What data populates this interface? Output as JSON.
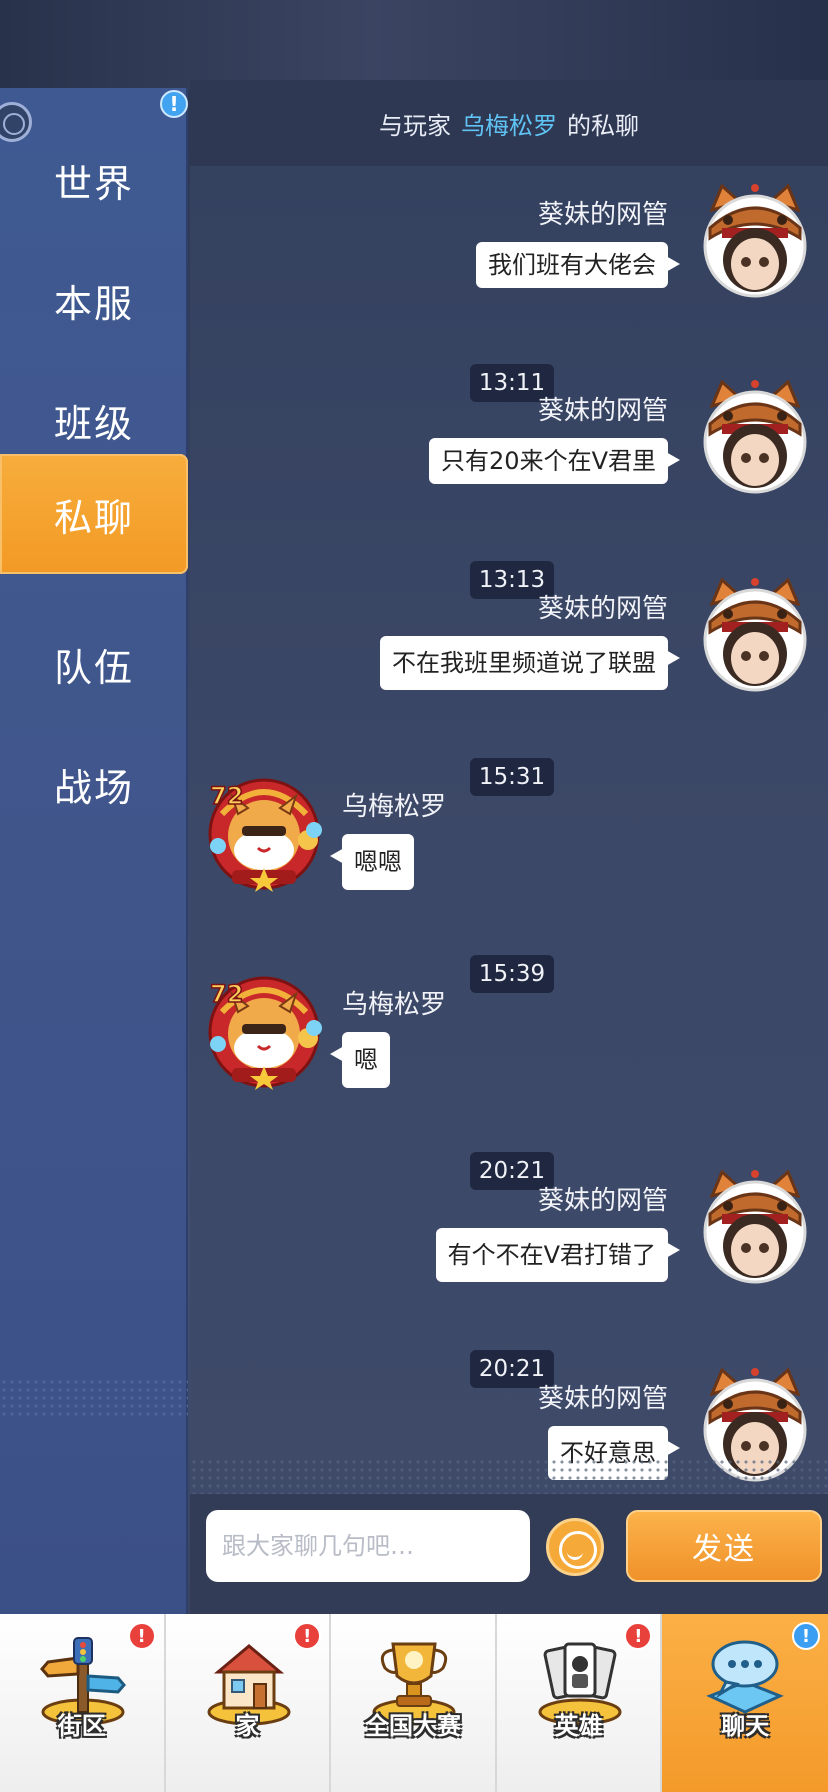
{
  "sidebar": {
    "items": [
      {
        "label": "世界"
      },
      {
        "label": "本服"
      },
      {
        "label": "班级"
      },
      {
        "label": "私聊"
      },
      {
        "label": "队伍"
      },
      {
        "label": "战场"
      }
    ],
    "active_index": 3,
    "alert_text": "!"
  },
  "chat": {
    "header_prefix": "与玩家",
    "header_name": "乌梅松罗",
    "header_suffix": "的私聊",
    "messages": [
      {
        "sender": "葵妹的网管",
        "text": "我们班有大佬会"
      },
      {
        "sender": "葵妹的网管",
        "text": "只有20来个在V君里"
      },
      {
        "sender": "葵妹的网管",
        "text": "不在我班里频道说了联盟"
      },
      {
        "sender": "乌梅松罗",
        "text": "嗯嗯"
      },
      {
        "sender": "乌梅松罗",
        "text": "嗯"
      },
      {
        "sender": "葵妹的网管",
        "text": "有个不在V君打错了"
      },
      {
        "sender": "葵妹的网管",
        "text": "不好意思"
      }
    ],
    "timestamps": [
      "13:11",
      "13:13",
      "15:31",
      "15:39",
      "20:21",
      "20:21"
    ],
    "avatar_badge_level": "72"
  },
  "input": {
    "placeholder": "跟大家聊几句吧…",
    "send_label": "发送"
  },
  "bottom_nav": {
    "items": [
      {
        "label": "街区",
        "badge": "!"
      },
      {
        "label": "家",
        "badge": "!"
      },
      {
        "label": "全国大赛",
        "badge": ""
      },
      {
        "label": "英雄",
        "badge": "!"
      },
      {
        "label": "聊天",
        "badge": "!"
      }
    ]
  },
  "colors": {
    "accent_orange": "#f39a25",
    "link_blue": "#5fc3f4",
    "badge_red": "#e8403a",
    "badge_blue": "#3b9ef2"
  }
}
